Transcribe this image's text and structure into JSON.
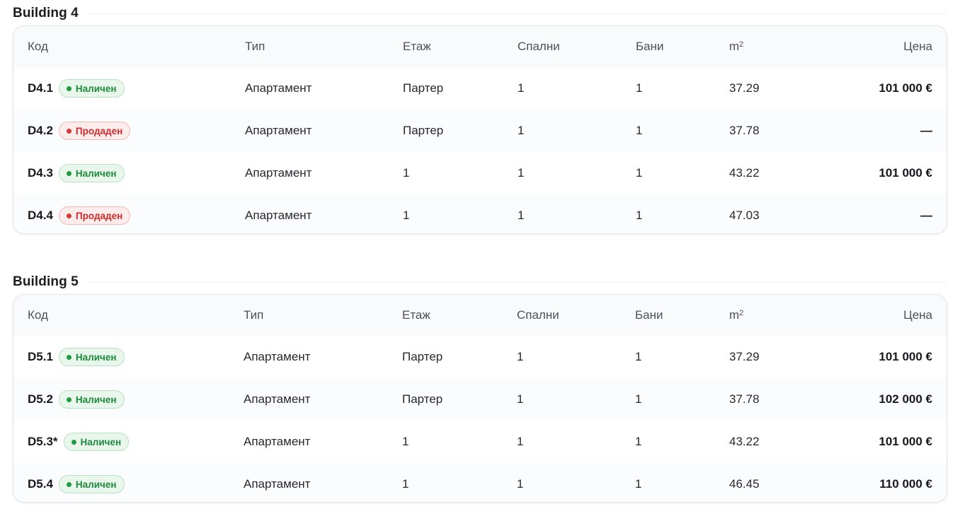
{
  "columns": {
    "code": "Код",
    "type": "Тип",
    "floor": "Етаж",
    "bedrooms": "Спални",
    "baths": "Бани",
    "area_base": "m",
    "area_sup": "2",
    "price": "Цена"
  },
  "status_colors": {
    "available": "#1e8a3c",
    "sold": "#cc2b2b"
  },
  "buildings": [
    {
      "title": "Building 4",
      "rows": [
        {
          "code": "D4.1",
          "status": "Наличен",
          "status_kind": "available",
          "type": "Апартамент",
          "floor": "Партер",
          "bedrooms": "1",
          "baths": "1",
          "area": "37.29",
          "price": "101 000 €"
        },
        {
          "code": "D4.2",
          "status": "Продаден",
          "status_kind": "sold",
          "type": "Апартамент",
          "floor": "Партер",
          "bedrooms": "1",
          "baths": "1",
          "area": "37.78",
          "price": "—"
        },
        {
          "code": "D4.3",
          "status": "Наличен",
          "status_kind": "available",
          "type": "Апартамент",
          "floor": "1",
          "bedrooms": "1",
          "baths": "1",
          "area": "43.22",
          "price": "101 000 €"
        },
        {
          "code": "D4.4",
          "status": "Продаден",
          "status_kind": "sold",
          "type": "Апартамент",
          "floor": "1",
          "bedrooms": "1",
          "baths": "1",
          "area": "47.03",
          "price": "—"
        }
      ]
    },
    {
      "title": "Building 5",
      "rows": [
        {
          "code": "D5.1",
          "status": "Наличен",
          "status_kind": "available",
          "type": "Апартамент",
          "floor": "Партер",
          "bedrooms": "1",
          "baths": "1",
          "area": "37.29",
          "price": "101 000 €"
        },
        {
          "code": "D5.2",
          "status": "Наличен",
          "status_kind": "available",
          "type": "Апартамент",
          "floor": "Партер",
          "bedrooms": "1",
          "baths": "1",
          "area": "37.78",
          "price": "102 000 €"
        },
        {
          "code": "D5.3*",
          "status": "Наличен",
          "status_kind": "available",
          "type": "Апартамент",
          "floor": "1",
          "bedrooms": "1",
          "baths": "1",
          "area": "43.22",
          "price": "101 000 €"
        },
        {
          "code": "D5.4",
          "status": "Наличен",
          "status_kind": "available",
          "type": "Апартамент",
          "floor": "1",
          "bedrooms": "1",
          "baths": "1",
          "area": "46.45",
          "price": "110 000 €"
        }
      ]
    }
  ]
}
